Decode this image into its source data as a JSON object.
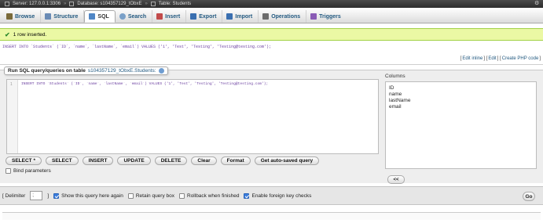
{
  "breadcrumb": {
    "server": "Server: 127.0.0.1:3306",
    "database": "Database: s104357129_tObxE",
    "table": "Table: Students"
  },
  "tabs": [
    {
      "label": "Browse",
      "icon": "browse-icon",
      "color": "#7a6a3a"
    },
    {
      "label": "Structure",
      "icon": "structure-icon",
      "color": "#6a8bb5"
    },
    {
      "label": "SQL",
      "icon": "sql-icon",
      "color": "#4f86c6",
      "active": true
    },
    {
      "label": "Search",
      "icon": "search-icon",
      "color": "#7aa0c8"
    },
    {
      "label": "Insert",
      "icon": "insert-icon",
      "color": "#c24b4b"
    },
    {
      "label": "Export",
      "icon": "export-icon",
      "color": "#3a6fb0"
    },
    {
      "label": "Import",
      "icon": "import-icon",
      "color": "#3a6fb0"
    },
    {
      "label": "Operations",
      "icon": "operations-icon",
      "color": "#6b6b6b"
    },
    {
      "label": "Triggers",
      "icon": "triggers-icon",
      "color": "#8a5bb5"
    }
  ],
  "message": {
    "text": "1 row inserted."
  },
  "sql_echo": "INSERT INTO `Students` (`ID`, `name`, `lastName`, `email`) VALUES ('1', 'Test', 'Testing', 'Testing@testing.com');",
  "links": {
    "edit_inline": "Edit inline",
    "edit": "Edit",
    "create_php": "Create PHP code"
  },
  "query_box": {
    "legend": "Run SQL query/queries on table",
    "table_name": "s104357129_tObxE.Students:",
    "line_number": "1",
    "code": "INSERT INTO `Students` (`ID`, `name`, `lastName`, `email`) VALUES ('1', 'Test', 'Testing', 'Testing@testing.com');"
  },
  "columns": {
    "title": "Columns",
    "items": [
      "ID",
      "name",
      "lastName",
      "email"
    ],
    "insert_label": "<<"
  },
  "buttons": {
    "select_star": "SELECT *",
    "select": "SELECT",
    "insert": "INSERT",
    "update": "UPDATE",
    "delete": "DELETE",
    "clear": "Clear",
    "format": "Format",
    "auto_saved": "Get auto-saved query"
  },
  "bind_parameters": "Bind parameters",
  "options": {
    "delimiter_label": "[ Delimiter",
    "delimiter_value": ";",
    "delimiter_close": "]",
    "show_again": "Show this query here again",
    "retain": "Retain query box",
    "rollback": "Rollback when finished",
    "foreign_keys": "Enable foreign key checks",
    "go": "Go"
  }
}
